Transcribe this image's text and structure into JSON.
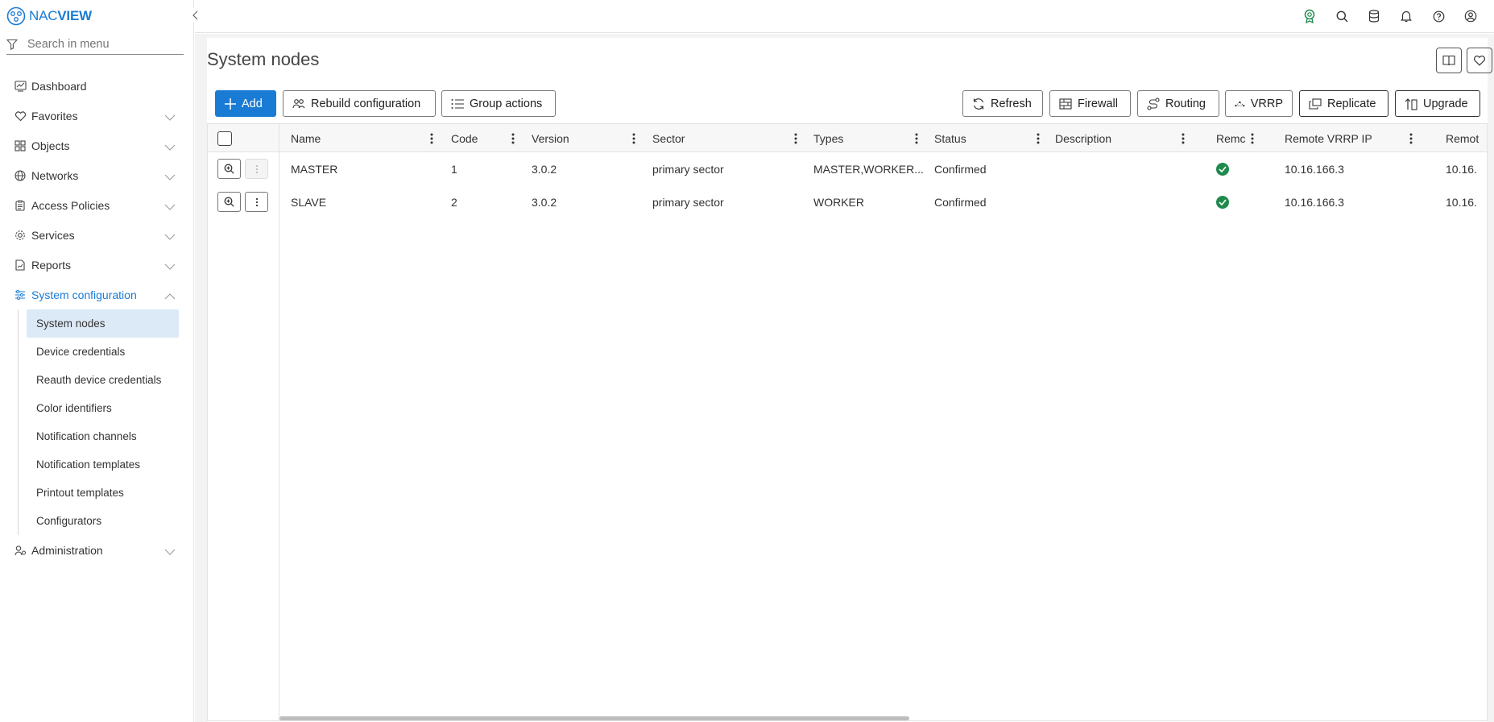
{
  "app": {
    "logo_prefix": "NAC",
    "logo_suffix": "VIEW"
  },
  "sidebar": {
    "search_placeholder": "Search in menu",
    "items": [
      {
        "label": "Dashboard",
        "icon": "dashboard-icon",
        "expandable": false
      },
      {
        "label": "Favorites",
        "icon": "heart-icon",
        "expandable": true
      },
      {
        "label": "Objects",
        "icon": "objects-icon",
        "expandable": true
      },
      {
        "label": "Networks",
        "icon": "globe-icon",
        "expandable": true
      },
      {
        "label": "Access Policies",
        "icon": "clipboard-icon",
        "expandable": true
      },
      {
        "label": "Services",
        "icon": "gear-icon",
        "expandable": true
      },
      {
        "label": "Reports",
        "icon": "report-icon",
        "expandable": true
      },
      {
        "label": "System configuration",
        "icon": "sliders-icon",
        "expandable": true,
        "expanded": true
      }
    ],
    "sub_items": [
      "System nodes",
      "Device credentials",
      "Reauth device credentials",
      "Color identifiers",
      "Notification channels",
      "Notification templates",
      "Printout templates",
      "Configurators"
    ],
    "selected_sub_item": "System nodes",
    "last_item": {
      "label": "Administration",
      "icon": "admin-icon"
    }
  },
  "page": {
    "title": "System nodes"
  },
  "toolbar": {
    "add": "Add",
    "rebuild": "Rebuild configuration",
    "group_actions": "Group actions",
    "refresh": "Refresh",
    "firewall": "Firewall",
    "routing": "Routing",
    "vrrp": "VRRP",
    "replicate": "Replicate",
    "upgrade": "Upgrade"
  },
  "table": {
    "columns": [
      "Name",
      "Code",
      "Version",
      "Sector",
      "Types",
      "Status",
      "Description",
      "Remc",
      "Remote VRRP IP",
      "Remot"
    ],
    "rows": [
      {
        "name": "MASTER",
        "code": "1",
        "version": "3.0.2",
        "sector": "primary sector",
        "types": "MASTER,WORKER...",
        "status": "Confirmed",
        "description": "",
        "remote_ok": true,
        "vrrp_ip": "10.16.166.3",
        "remote2": "10.16."
      },
      {
        "name": "SLAVE",
        "code": "2",
        "version": "3.0.2",
        "sector": "primary sector",
        "types": "WORKER",
        "status": "Confirmed",
        "description": "",
        "remote_ok": true,
        "vrrp_ip": "10.16.166.3",
        "remote2": "10.16."
      }
    ]
  },
  "colors": {
    "accent": "#1a7bd4",
    "ok": "#1f8a4c",
    "selected_bg": "#dce9f7"
  }
}
